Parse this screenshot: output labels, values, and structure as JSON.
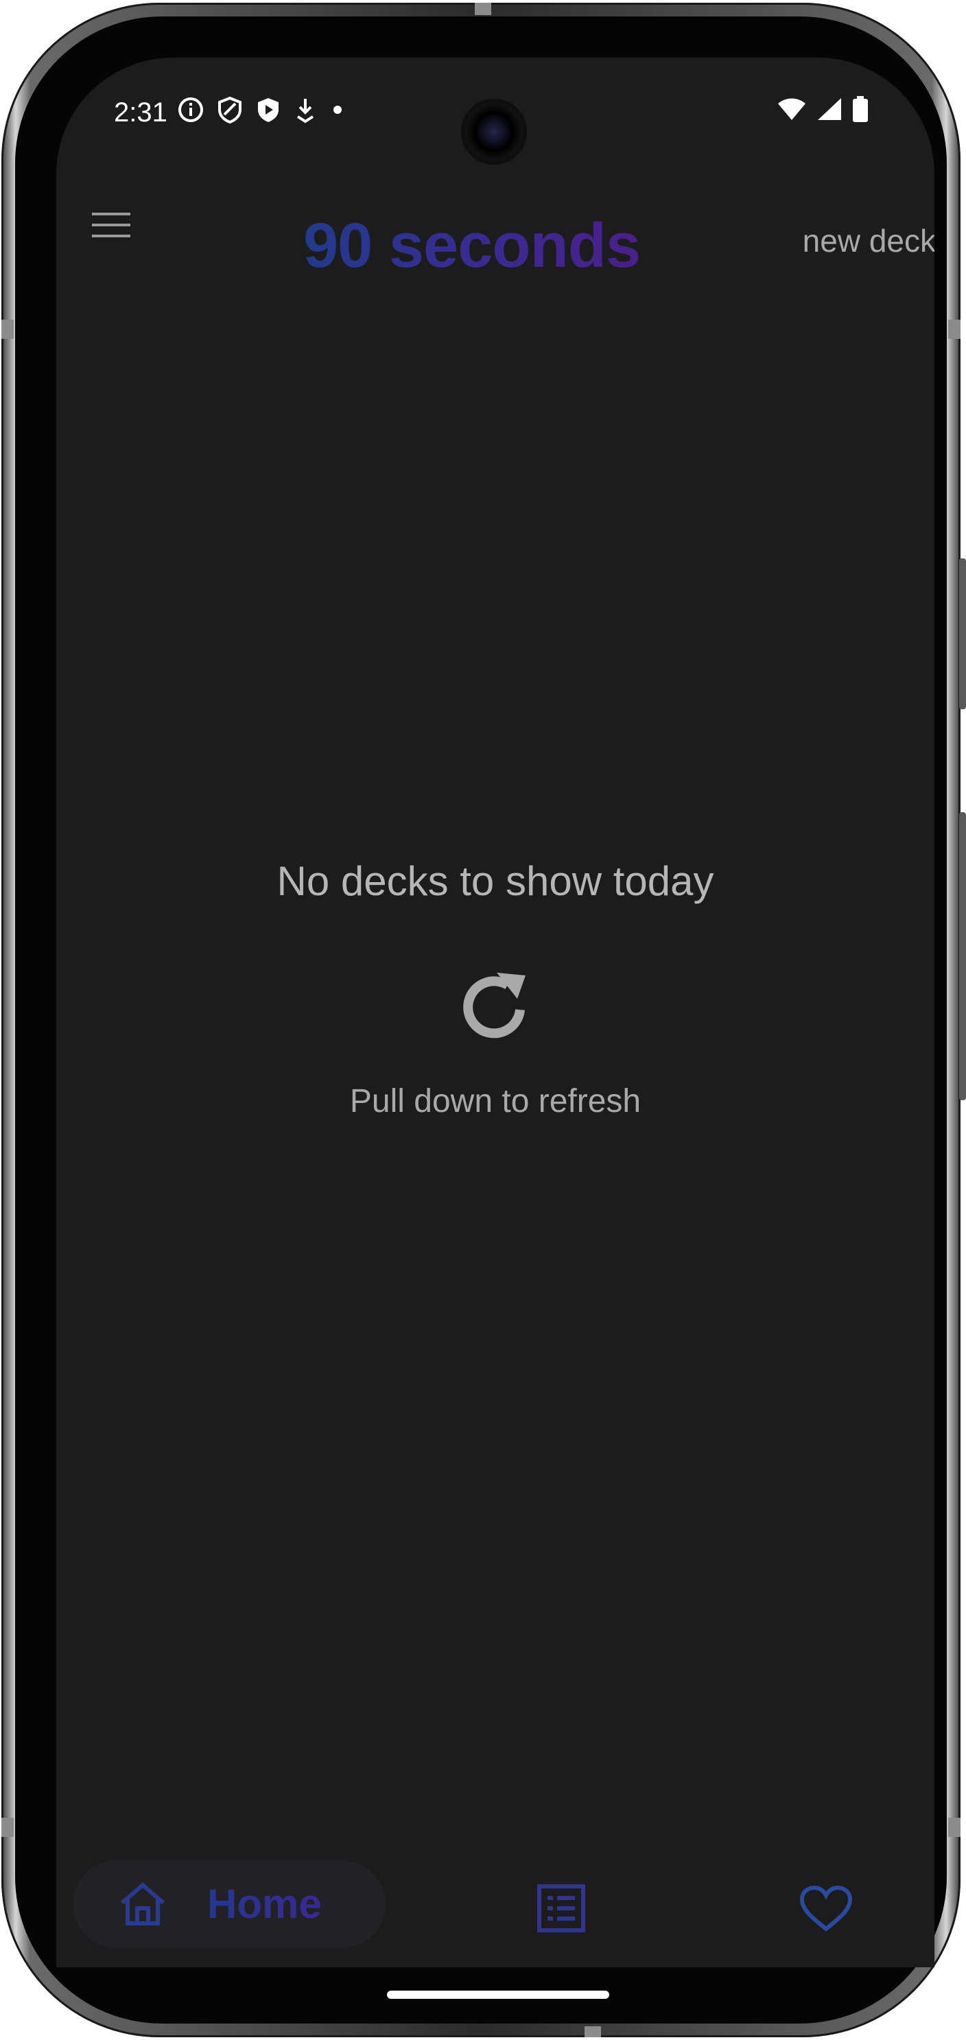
{
  "status_bar": {
    "time": "2:31",
    "left_icons": [
      "info-icon",
      "shield-icon",
      "play-shield-icon",
      "download-icon",
      "dot-icon"
    ],
    "right_icons": [
      "wifi-icon",
      "cell-signal-icon",
      "battery-icon"
    ]
  },
  "header": {
    "title": "90 seconds",
    "action_label": "new deck",
    "menu_icon": "hamburger-menu-icon"
  },
  "empty_state": {
    "title": "No decks to show today",
    "icon": "refresh-icon",
    "subtitle": "Pull down to refresh"
  },
  "bottom_nav": {
    "items": [
      {
        "label": "Home",
        "icon": "home-icon",
        "selected": true
      },
      {
        "label": "",
        "icon": "list-icon",
        "selected": false
      },
      {
        "label": "",
        "icon": "heart-icon",
        "selected": false
      }
    ]
  },
  "colors": {
    "background": "#1c1c1d",
    "accent_start": "#223a8c",
    "accent_end": "#4a1f8a",
    "text_muted": "#a9a9a9"
  }
}
